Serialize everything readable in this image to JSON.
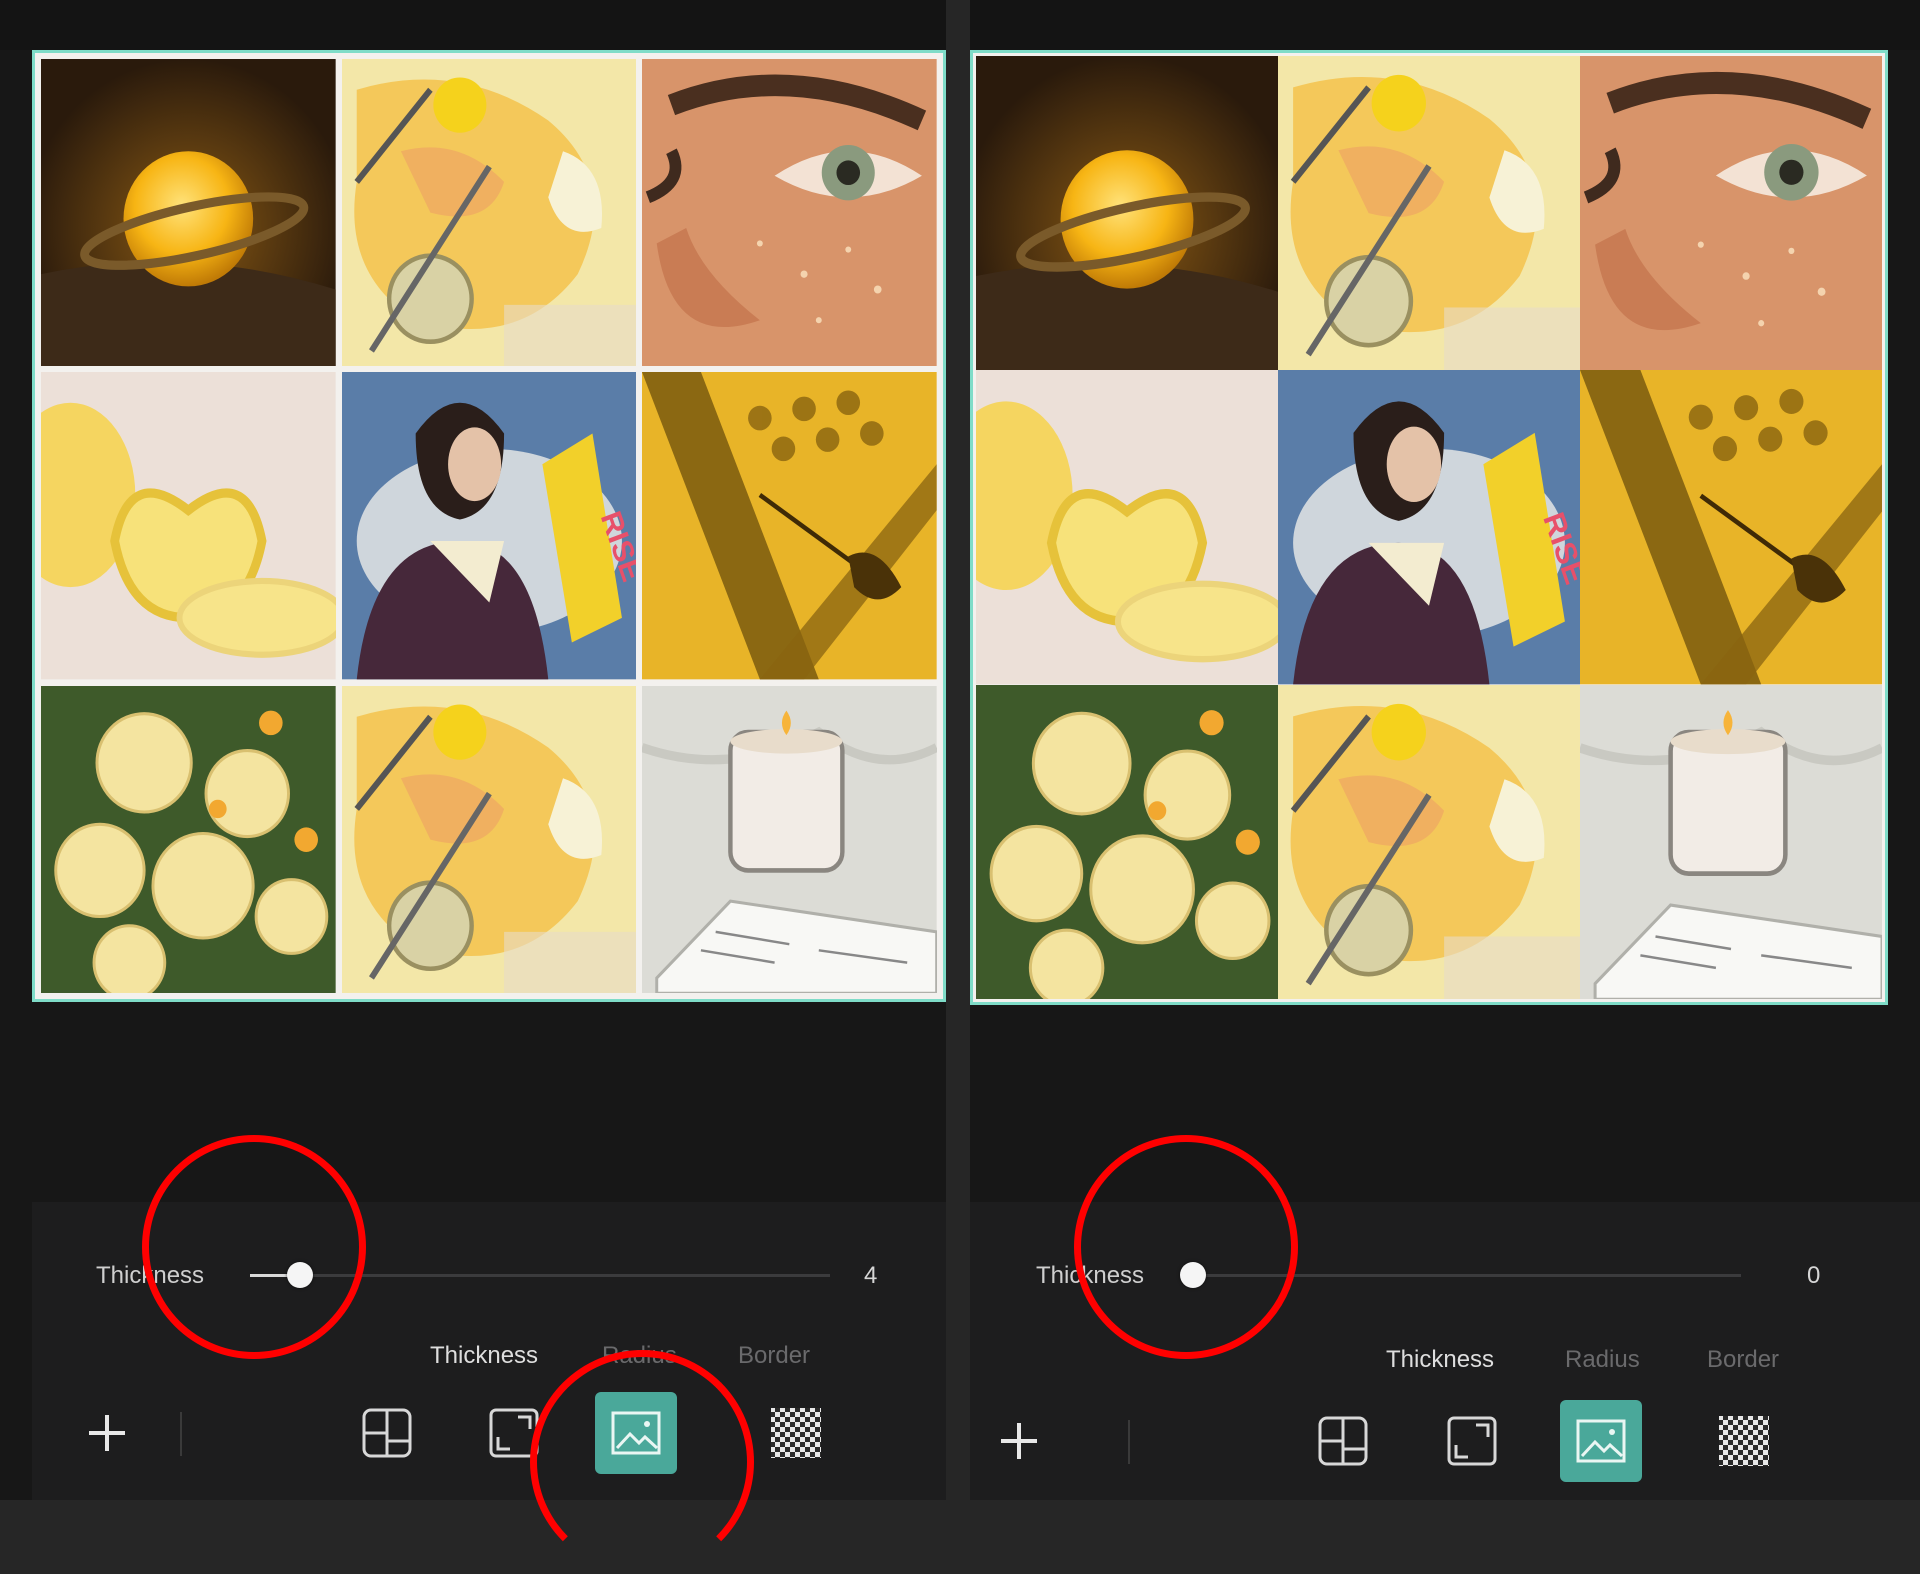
{
  "panels": [
    {
      "slider": {
        "label": "Thickness",
        "value": "4",
        "level": 0.03
      },
      "tabs": [
        {
          "label": "Thickness",
          "active": true
        },
        {
          "label": "Radius",
          "active": false
        },
        {
          "label": "Border",
          "active": false
        }
      ],
      "tools": [
        "add-icon",
        "layout-icon",
        "ratio-icon",
        "background-image-icon",
        "transparency-icon"
      ],
      "selected_tool": "background-image-icon",
      "annotations": [
        "thickness-slider-knob",
        "background-image-tool"
      ]
    },
    {
      "slider": {
        "label": "Thickness",
        "value": "0",
        "level": 0.0
      },
      "tabs": [
        {
          "label": "Thickness",
          "active": true
        },
        {
          "label": "Radius",
          "active": false
        },
        {
          "label": "Border",
          "active": false
        }
      ],
      "tools": [
        "add-icon",
        "layout-icon",
        "ratio-icon",
        "background-image-icon",
        "transparency-icon"
      ],
      "selected_tool": "background-image-icon",
      "annotations": [
        "thickness-slider-knob"
      ]
    }
  ],
  "collage_tiles": [
    "saturn-lamp",
    "paint-palette",
    "freckled-eye",
    "lemons",
    "woman-megaphone",
    "shadow-flower",
    "yellow-roses",
    "paint-palette",
    "candle-book"
  ],
  "megaphone_text": "RISE",
  "colors": {
    "accent": "#4aa89a",
    "selection_border": "#7fdcc8",
    "annotation": "#ff0000"
  }
}
